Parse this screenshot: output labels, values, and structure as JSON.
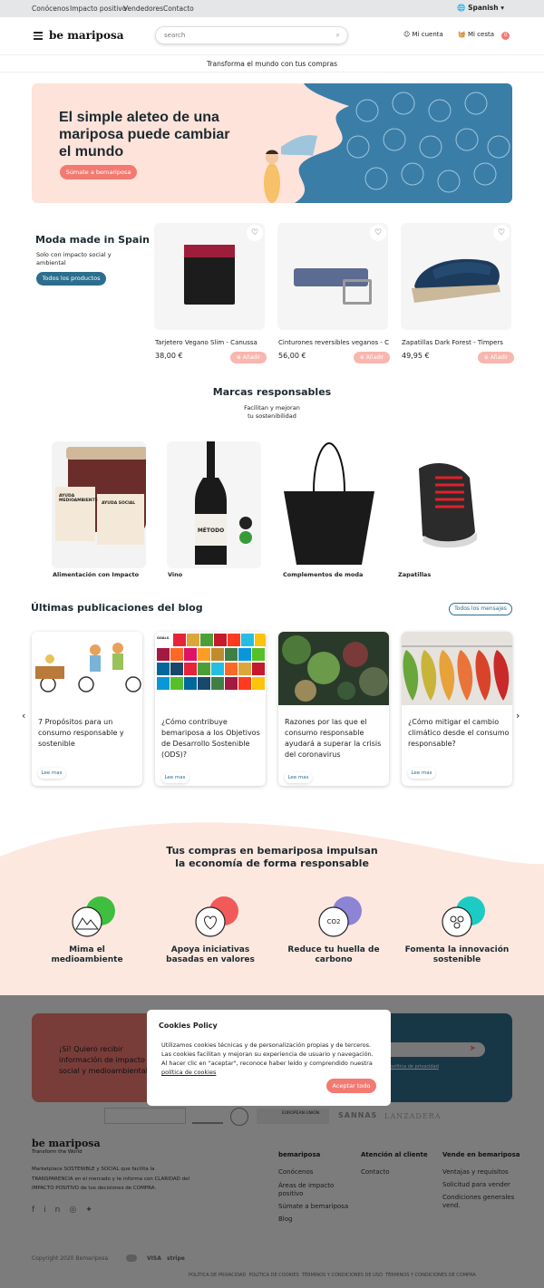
{
  "topbar": {
    "links": [
      "Conócenos",
      "Impacto positivo",
      "Vendedores",
      "Contacto"
    ],
    "language": "Spanish"
  },
  "header": {
    "logo": "be mariposa",
    "search_placeholder": "search",
    "account": "Mi cuenta",
    "cart": "Mi cesta",
    "cart_count": "0"
  },
  "tagline": "Transforma el mundo con tus compras",
  "hero": {
    "title": "El simple aleteo de una mariposa puede cambiar el mundo",
    "cta": "Súmate a bemariposa"
  },
  "products_section": {
    "title": "Moda made in Spain",
    "subtitle": "Solo con impacto social y ambiental",
    "cta": "Todos los productos",
    "add_label": "Añadir",
    "items": [
      {
        "name": "Tarjetero Vegano Slim - Canussa",
        "price": "38,00 €"
      },
      {
        "name": "Cinturones reversibles veganos - C...",
        "price": "56,00 €"
      },
      {
        "name": "Zapatillas Dark Forest - Timpers",
        "price": "49,95 €"
      }
    ]
  },
  "brands": {
    "title": "Marcas responsables",
    "subtitle_1": "Facilitan y mejoran",
    "subtitle_2": "tu sostenibilidad",
    "items": [
      "Alimentación con Impacto",
      "Vino",
      "Complementos de moda",
      "Zapatillas"
    ],
    "jar_text_1": "AYUDA MEDIOAMBIENTE",
    "jar_text_2": "AYUDA SOCIAL",
    "wine_label": "MÉTODO"
  },
  "blog": {
    "title": "Últimas publicaciones del blog",
    "all_button": "Todos los mensajes",
    "read_more": "Lee mas",
    "sdg_label": "GOALS",
    "posts": [
      "7 Propósitos para un consumo responsable y sostenible",
      "¿Cómo contribuye bemariposa a los Objetivos de Desarrollo Sostenible (ODS)?",
      "Razones por las que el consumo responsable ayudará a superar la crisis del coronavirus",
      "¿Cómo mitigar el cambio climático desde el consumo responsable?"
    ]
  },
  "impact": {
    "title_1": "Tus compras en bemariposa impulsan",
    "title_2": "la economía de forma responsable",
    "co2": "CO2",
    "items": [
      {
        "label": "Mima el medioambiente",
        "color": "#3fbf3f"
      },
      {
        "label": "Apoya iniciativas basadas en valores",
        "color": "#f25a5a"
      },
      {
        "label": "Reduce tu huella de carbono",
        "color": "#8d84d6"
      },
      {
        "label": "Fomenta la innovación sostenible",
        "color": "#1ccbc4"
      }
    ]
  },
  "newsletter": {
    "text": "¡Sí! Quiero recibir información de impacto social y medioambiental",
    "privacy": "política de privacidad"
  },
  "partners": [
    "EUROPEAN UNION",
    "SANNAS",
    "LANZADERA"
  ],
  "footer": {
    "logo": "be mariposa",
    "logo_tag": "Transform the World",
    "desc": "Marketplace SOSTENIBLE y SOCIAL que facilita la TRANSPARENCIA en el mercado y te informa con CLARIDAD del IMPACTO POSITIVO de tus decisiones de COMPRA.",
    "social": [
      "f",
      "in",
      "◎",
      "✦"
    ],
    "cols": [
      {
        "title": "bemariposa",
        "links": [
          "Conócenos",
          "Áreas de impacto positivo",
          "Súmate a bemariposa",
          "Blog"
        ]
      },
      {
        "title": "Atención al cliente",
        "links": [
          "Contacto"
        ]
      },
      {
        "title": "Vende en bemariposa",
        "links": [
          "Ventajas y requisitos",
          "Solicitud para vender",
          "Condiciones generales vend."
        ]
      }
    ],
    "copyright": "Copyright 2020 Bemariposa",
    "payments": [
      "VISA",
      "stripe"
    ],
    "legal": [
      "POLÍTICA DE PRIVACIDAD",
      "POLÍTICA DE COOKIES",
      "TÉRMINOS Y CONDICIONES DE USO",
      "TÉRMINOS Y CONDICIONES DE COMPRA"
    ]
  },
  "cookies": {
    "title": "Cookies Policy",
    "body": "Utilizamos cookies técnicas y de personalización propias y de terceros. Las cookies facilitan y mejoran su experiencia de usuario y navegación. Al hacer clic en \"aceptar\", reconoce haber leído y comprendido nuestra",
    "link": "política de cookies",
    "accept": "Aceptar todo"
  }
}
